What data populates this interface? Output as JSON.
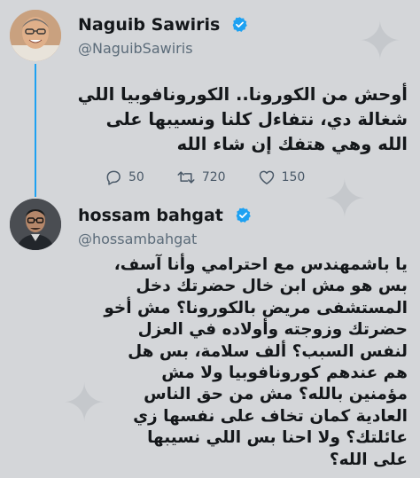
{
  "tweet1": {
    "name": "Naguib Sawiris",
    "handle": "@NaguibSawiris",
    "lines": [
      "أوحش من الكورونا.. الكورونافوبيا اللي",
      "شغالة دي، نتفاءل كلنا ونسيبها على",
      "الله وهي هتفك إن شاء الله"
    ],
    "replies": "50",
    "retweets": "720",
    "likes": "150"
  },
  "tweet2": {
    "name": "hossam bahgat",
    "handle": "@hossambahgat",
    "lines": [
      "يا باشمهندس مع احترامي وأنا آسف،",
      "بس هو مش ابن خال حضرتك دخل",
      "المستشفى مريض بالكورونا؟ مش أخو",
      "حضرتك وزوجته وأولاده في العزل",
      "لنفس السبب؟ ألف سلامة، بس هل",
      "هم عندهم كورونافوبيا ولا مش",
      "مؤمنين بالله؟ مش من حق الناس",
      "العادية كمان تخاف على نفسها زي",
      "عائلتك؟ ولا احنا بس اللي نسيبها",
      "على الله؟"
    ]
  },
  "colors": {
    "accent": "#1da1f2",
    "text": "#14171a",
    "muted": "#5b6b79",
    "background": "#d4d6d9"
  },
  "icons": [
    "verified-badge-icon",
    "reply-icon",
    "retweet-icon",
    "like-icon"
  ]
}
